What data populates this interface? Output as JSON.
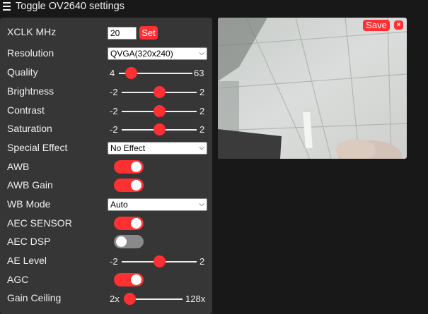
{
  "header": {
    "title": "Toggle OV2640 settings",
    "menu_icon": "hamburger-icon"
  },
  "colors": {
    "accent": "#ff3034",
    "panel": "#363636",
    "background": "#181818"
  },
  "settings": {
    "xclk": {
      "label": "XCLK MHz",
      "value": "20",
      "button": "Set"
    },
    "resolution": {
      "label": "Resolution",
      "selected": "QVGA(320x240)"
    },
    "quality": {
      "label": "Quality",
      "min": "4",
      "max": "63",
      "value": 10
    },
    "brightness": {
      "label": "Brightness",
      "min": "-2",
      "max": "2",
      "value": 0
    },
    "contrast": {
      "label": "Contrast",
      "min": "-2",
      "max": "2",
      "value": 0
    },
    "saturation": {
      "label": "Saturation",
      "min": "-2",
      "max": "2",
      "value": 0
    },
    "special_effect": {
      "label": "Special Effect",
      "selected": "No Effect"
    },
    "awb": {
      "label": "AWB",
      "on": true
    },
    "awb_gain": {
      "label": "AWB Gain",
      "on": true
    },
    "wb_mode": {
      "label": "WB Mode",
      "selected": "Auto"
    },
    "aec_sensor": {
      "label": "AEC SENSOR",
      "on": true
    },
    "aec_dsp": {
      "label": "AEC DSP",
      "on": false
    },
    "ae_level": {
      "label": "AE Level",
      "min": "-2",
      "max": "2",
      "value": 0
    },
    "agc": {
      "label": "AGC",
      "on": true
    },
    "gain_ceiling": {
      "label": "Gain Ceiling",
      "min": "2x",
      "max": "128x",
      "value": 0
    }
  },
  "preview": {
    "save_label": "Save",
    "close_label": "×"
  }
}
